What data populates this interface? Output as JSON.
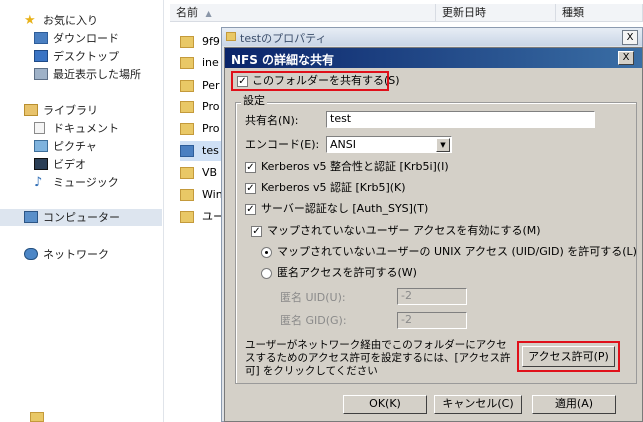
{
  "nav": {
    "favorites": "お気に入り",
    "downloads": "ダウンロード",
    "desktop": "デスクトップ",
    "recent": "最近表示した場所",
    "libraries": "ライブラリ",
    "documents": "ドキュメント",
    "pictures": "ピクチャ",
    "videos": "ビデオ",
    "music": "ミュージック",
    "computer": "コンピューター",
    "network": "ネットワーク"
  },
  "list": {
    "col_name": "名前",
    "col_date": "更新日時",
    "col_type": "種類",
    "files": [
      "9f9",
      "ine",
      "Per",
      "Pro",
      "Pro",
      "tes",
      "VB",
      "Win",
      "ユー"
    ]
  },
  "properties": {
    "title": "testのプロパティ",
    "close": "X"
  },
  "nfs": {
    "title": "NFS の詳細な共有",
    "close": "X",
    "share_folder": "このフォルダーを共有する(S)",
    "settings_group": "設定",
    "share_name_label": "共有名(N):",
    "share_name_value": "test",
    "encode_label": "エンコード(E):",
    "encode_value": "ANSI",
    "krb5i": "Kerberos v5 整合性と認証 [Krb5i](I)",
    "krb5": "Kerberos v5 認証 [Krb5](K)",
    "auth_sys": "サーバー認証なし [Auth_SYS](T)",
    "unmapped": "マップされていないユーザー アクセスを有効にする(M)",
    "allow_unix": "マップされていないユーザーの UNIX アクセス (UID/GID) を許可する(L)",
    "allow_anon": "匿名アクセスを許可する(W)",
    "anon_uid_label": "匿名 UID(U):",
    "anon_uid_value": "-2",
    "anon_gid_label": "匿名 GID(G):",
    "anon_gid_value": "-2",
    "perm_text": "ユーザーがネットワーク経由でこのフォルダーにアクセスするためのアクセス許可を設定するには、[アクセス許可] をクリックしてください",
    "perm_button": "アクセス許可(P)",
    "ok": "OK(K)",
    "cancel": "キャンセル(C)",
    "apply": "適用(A)"
  },
  "colors": {
    "highlight": "#e0101a",
    "title_bar": "#0a246a",
    "dialog_bg": "#d4d0c8"
  }
}
